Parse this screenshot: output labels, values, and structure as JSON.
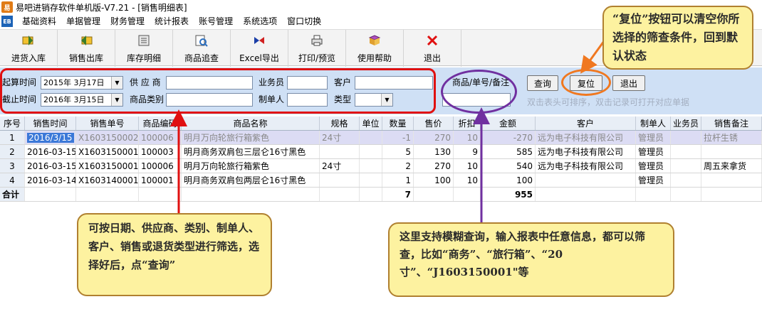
{
  "window": {
    "title": "易吧进销存软件单机版-V7.21 - [销售明细表]"
  },
  "menu": {
    "items": [
      "基础资料",
      "单据管理",
      "财务管理",
      "统计报表",
      "账号管理",
      "系统选项",
      "窗口切换"
    ]
  },
  "toolbar": {
    "items": [
      {
        "label": "进货入库",
        "icon": "stock-in-icon"
      },
      {
        "label": "销售出库",
        "icon": "sales-out-icon"
      },
      {
        "label": "库存明细",
        "icon": "inventory-icon"
      },
      {
        "label": "商品追查",
        "icon": "product-trace-icon"
      },
      {
        "label": "Excel导出",
        "icon": "excel-export-icon"
      },
      {
        "label": "打印/预览",
        "icon": "print-icon"
      },
      {
        "label": "使用帮助",
        "icon": "help-icon"
      },
      {
        "label": "退出",
        "icon": "exit-icon"
      }
    ]
  },
  "filter": {
    "start_label": "起算时间",
    "start_value": "2015年 3月17日",
    "end_label": "截止时间",
    "end_value": "2016年 3月15日",
    "supplier_label": "供 应 商",
    "supplier_value": "",
    "category_label": "商品类别",
    "category_value": "",
    "salesman_label": "业务员",
    "salesman_value": "",
    "maker_label": "制单人",
    "maker_value": "",
    "customer_label": "客户",
    "customer_value": "",
    "type_label": "类型",
    "type_value": "",
    "keyword_label": "商品/单号/备注",
    "keyword_value": "",
    "query_button": "查询",
    "reset_button": "复位",
    "exit_button": "退出",
    "hint": "双击表头可排序，双击记录可打开对应单据"
  },
  "table": {
    "columns": [
      "序号",
      "销售时间",
      "销售单号",
      "商品编码",
      "商品名称",
      "规格",
      "单位",
      "数量",
      "售价",
      "折扣",
      "金额",
      "客户",
      "制单人",
      "业务员",
      "销售备注"
    ],
    "rows": [
      [
        "1",
        "2016/3/15",
        "X1603150002",
        "100006",
        "明月万向轮旅行箱紫色",
        "24寸",
        "",
        "-1",
        "270",
        "10",
        "-270",
        "远为电子科技有限公司",
        "管理员",
        "",
        "拉杆生锈"
      ],
      [
        "2",
        "2016-03-15",
        "X1603150001",
        "100003",
        "明月商务双肩包三层仑16寸黑色",
        "",
        "",
        "5",
        "130",
        "9",
        "585",
        "远为电子科技有限公司",
        "管理员",
        "",
        ""
      ],
      [
        "3",
        "2016-03-15",
        "X1603150001",
        "100006",
        "明月万向轮旅行箱紫色",
        "24寸",
        "",
        "2",
        "270",
        "10",
        "540",
        "远为电子科技有限公司",
        "管理员",
        "",
        "周五来拿货"
      ],
      [
        "4",
        "2016-03-14",
        "X1603140001",
        "100001",
        "明月商务双肩包两层仑16寸黑色",
        "",
        "",
        "1",
        "100",
        "10",
        "100",
        "",
        "管理员",
        "",
        ""
      ]
    ],
    "total": {
      "label": "合计",
      "qty": "7",
      "amount": "955"
    }
  },
  "callouts": {
    "reset": "“复位”按钮可以清空你所选择的筛查条件，回到默认状态",
    "filter": "可按日期、供应商、类别、制单人、客户、销售或退货类型进行筛选，选择好后，点“查询”",
    "fuzzy": "这里支持模糊查询，输入报表中任意信息，都可以筛查，比如“商务”、“旅行箱”、“20寸”、“J1603150001\"等"
  },
  "colors": {
    "annotation_red": "#e01010",
    "annotation_purple": "#7030a0",
    "annotation_orange": "#f07820",
    "callout_fill": "#fdf2a0",
    "filter_panel": "#cfe0f5"
  }
}
